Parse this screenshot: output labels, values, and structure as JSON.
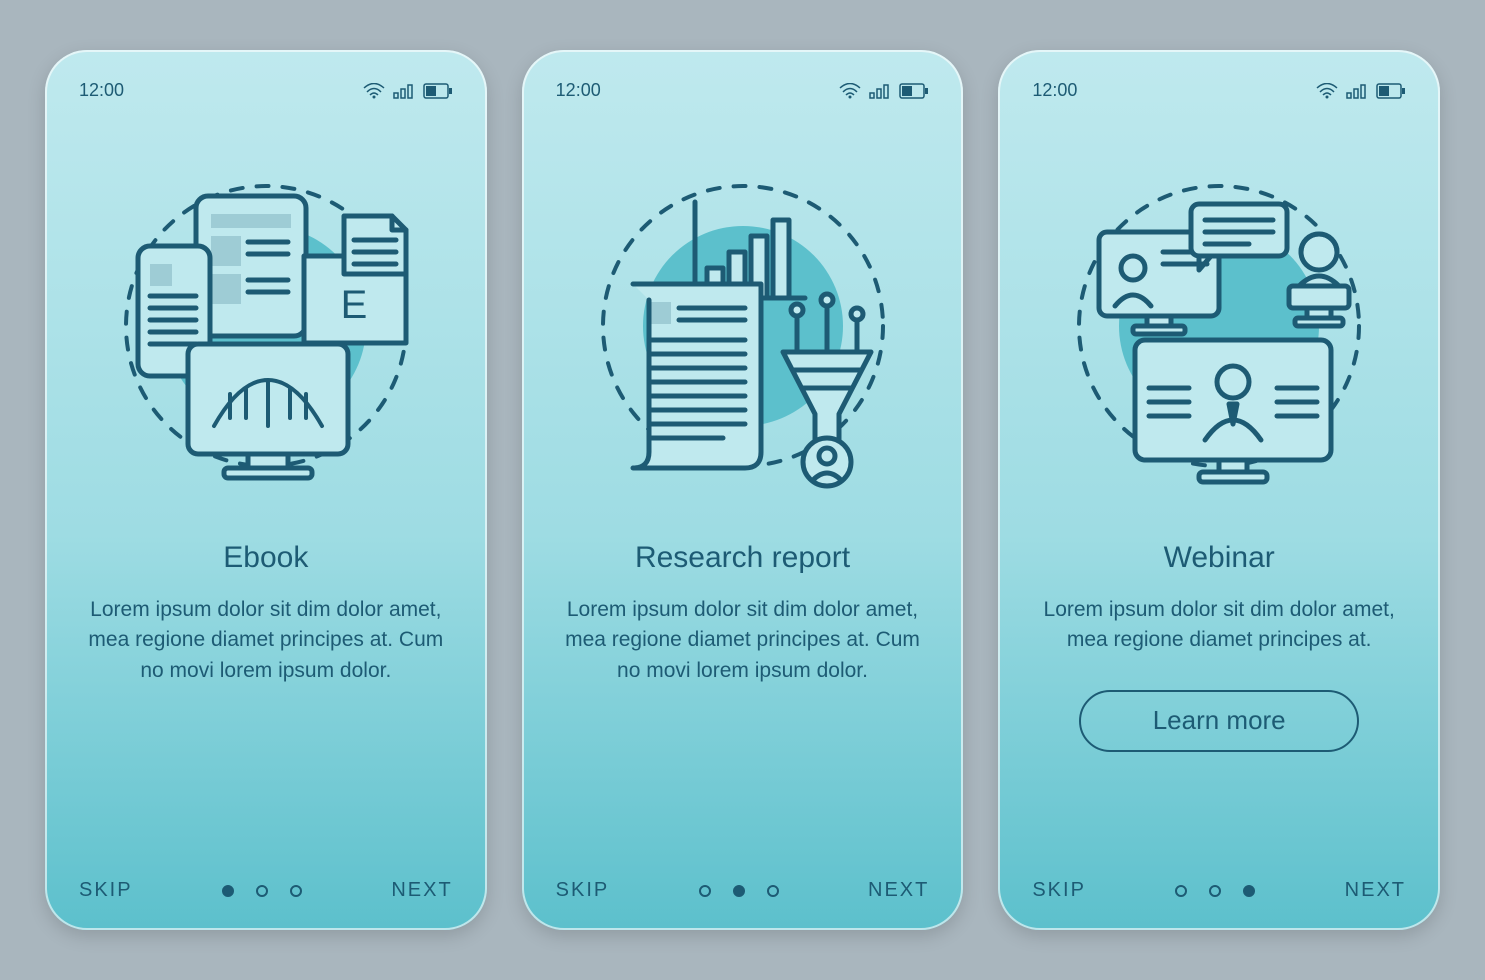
{
  "status": {
    "time": "12:00"
  },
  "nav": {
    "skip": "SKIP",
    "next": "NEXT"
  },
  "screens": [
    {
      "title": "Ebook",
      "desc": "Lorem ipsum dolor sit dim dolor amet, mea regione diamet principes at. Cum no movi lorem ipsum dolor.",
      "activeDot": 0
    },
    {
      "title": "Research report",
      "desc": "Lorem ipsum dolor sit dim dolor amet, mea regione diamet principes at. Cum no movi lorem ipsum dolor.",
      "activeDot": 1
    },
    {
      "title": "Webinar",
      "desc": "Lorem ipsum dolor sit dim dolor amet, mea regione diamet principes at.",
      "activeDot": 2,
      "cta": "Learn more"
    }
  ],
  "colors": {
    "stroke": "#1d5b74",
    "accent": "#5cc0cc",
    "fill": "#bfe9ee"
  }
}
